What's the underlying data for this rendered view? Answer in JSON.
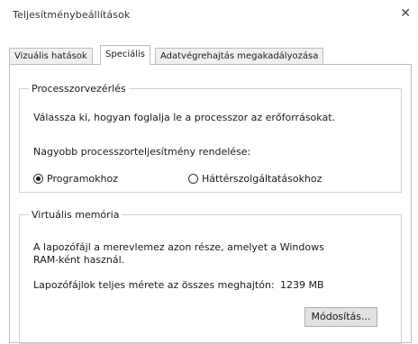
{
  "window": {
    "title": "Teljesítménybeállítások",
    "close_glyph": "✕"
  },
  "tabs": [
    {
      "label": "Vizuális hatások",
      "active": false
    },
    {
      "label": "Speciális",
      "active": true
    },
    {
      "label": "Adatvégrehajtás megakadályozása",
      "active": false
    }
  ],
  "processor": {
    "title": "Processzorvezérlés",
    "description": "Válassza ki, hogyan foglalja le a processzor az erőforrásokat.",
    "prompt": "Nagyobb processzorteljesítmény rendelése:",
    "options": [
      {
        "label": "Programokhoz",
        "selected": true
      },
      {
        "label": "Háttérszolgáltatásokhoz",
        "selected": false
      }
    ]
  },
  "virtual_memory": {
    "title": "Virtuális memória",
    "description_line1": "A lapozófájl a merevlemez azon része, amelyet a Windows",
    "description_line2": "RAM-ként használ.",
    "total_size_label": "Lapozófájlok teljes mérete az összes meghajtón:",
    "total_size_value": "1239 MB",
    "change_button": "Módosítás..."
  }
}
